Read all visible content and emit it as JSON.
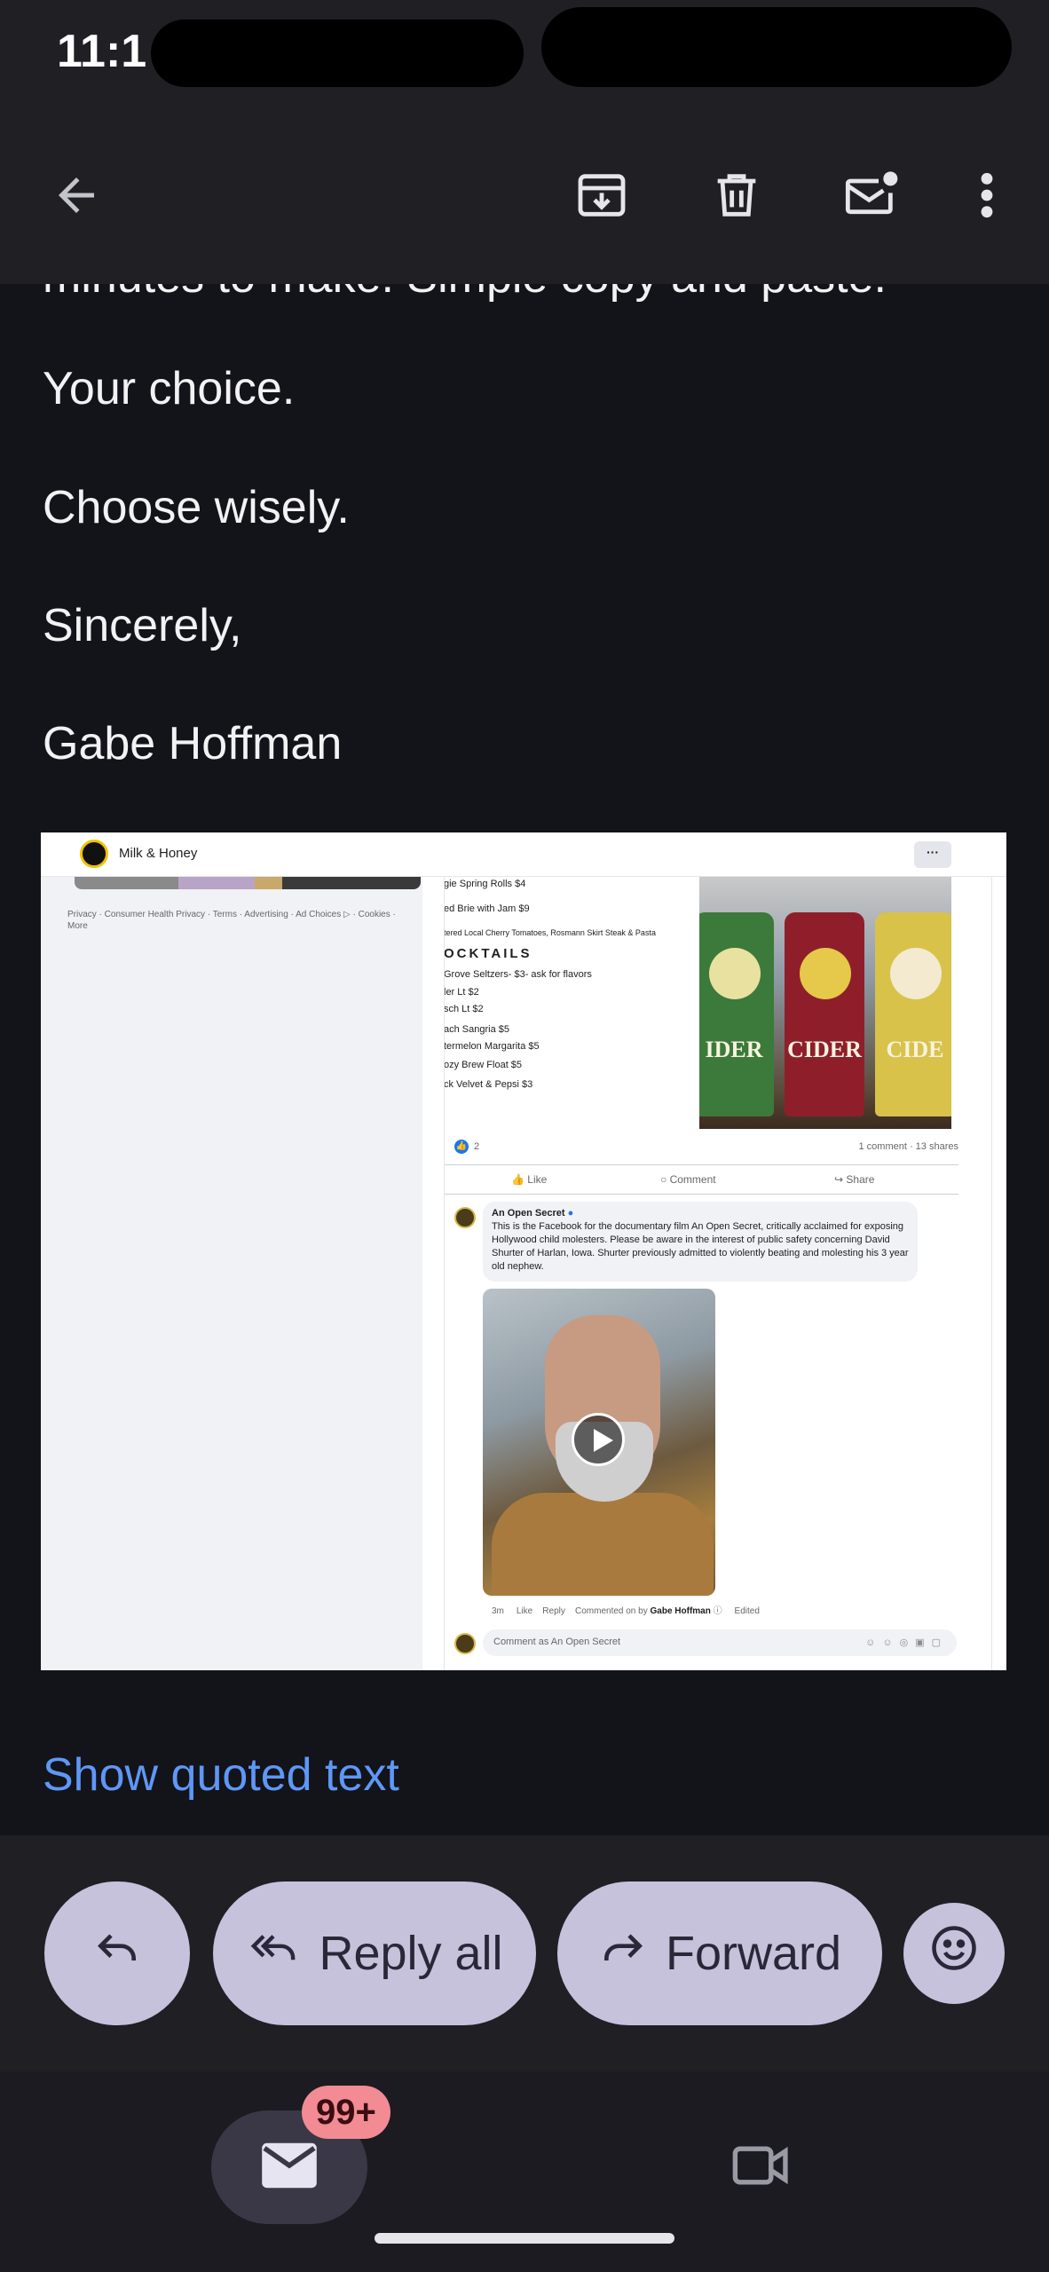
{
  "status_bar": {
    "time": "11:1"
  },
  "top_bar": {
    "back_icon": "arrow-left-icon",
    "archive_icon": "archive-icon",
    "delete_icon": "trash-icon",
    "mark_unread_icon": "mail-unread-icon",
    "more_icon": "more-vert-icon"
  },
  "email": {
    "cut_line": "minutes to make.  Simple copy and paste.",
    "paragraphs": [
      "Your choice.",
      "Choose wisely.",
      "Sincerely,",
      "Gabe Hoffman"
    ],
    "show_quoted_text": "Show quoted text"
  },
  "embedded_screenshot": {
    "page_name": "Milk & Honey",
    "more_label": "···",
    "footer_links": "Privacy · Consumer Health Privacy · Terms · Advertising · Ad Choices ▷ · Cookies · More",
    "menu_lines": [
      "gie Spring Rolls $4",
      "ed Brie with Jam $9",
      "tered Local Cherry Tomatoes, Rosmann Skirt Steak & Pasta",
      "OCKTAILS",
      " Grove Seltzers- $3- ask for flavors",
      "ler Lt $2",
      "sch Lt $2",
      "ach Sangria $5",
      "termelon Margarita $5",
      "ozy Brew Float $5",
      "ck Velvet & Pepsi $3"
    ],
    "can_labels": [
      "IDER",
      "CIDER",
      "CIDE"
    ],
    "reaction_count": "2",
    "comments_shares": "1 comment · 13 shares",
    "like": "Like",
    "comment": "Comment",
    "share": "Share",
    "commenter": "An Open Secret",
    "comment_text": "This is the Facebook for the documentary film An Open Secret, critically acclaimed for exposing Hollywood child molesters. Please be aware in the interest of public safety concerning David Shurter of Harlan, Iowa. Shurter previously admitted to violently beating and molesting his 3 year old nephew.",
    "comment_meta": {
      "time": "3m",
      "like": "Like",
      "reply": "Reply",
      "commented_by": "Commented on by",
      "author": "Gabe Hoffman",
      "edited": "Edited"
    },
    "composer_placeholder": "Comment as An Open Secret"
  },
  "actions": {
    "reply_icon": "reply-icon",
    "reply_all": "Reply all",
    "forward": "Forward",
    "emoji_icon": "emoji-icon"
  },
  "bottom_nav": {
    "mail_icon": "mail-icon",
    "mail_badge": "99+",
    "meet_icon": "videocam-icon"
  },
  "colors": {
    "background": "#13131a",
    "bar": "#1f1f24",
    "pill": "#c6c2dc",
    "link": "#5e97f6",
    "badge": "#f28b93"
  }
}
